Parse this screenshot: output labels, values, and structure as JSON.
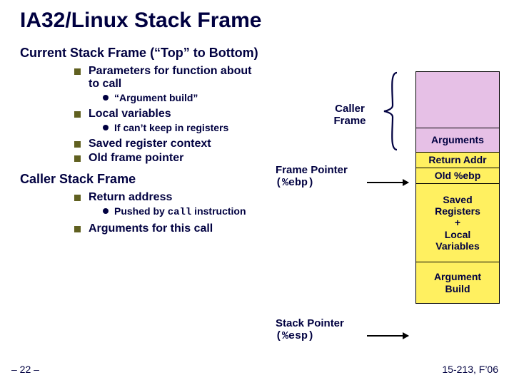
{
  "title": "IA32/Linux Stack Frame",
  "current": {
    "heading": "Current Stack Frame (“Top” to Bottom)",
    "b1": "Parameters for function about to call",
    "b1a": "“Argument build”",
    "b2": "Local variables",
    "b2a": "If can’t keep in registers",
    "b3": "Saved register context",
    "b4": "Old frame pointer"
  },
  "caller": {
    "heading": "Caller Stack Frame",
    "b1": "Return address",
    "b1a_pre": "Pushed by ",
    "b1a_code": "call",
    "b1a_post": " instruction",
    "b2": "Arguments for this call"
  },
  "diagram": {
    "caller_label": "Caller Frame",
    "args": "Arguments",
    "ret": "Return Addr",
    "old": "Old %ebp",
    "saved": "Saved\nRegisters\n+\nLocal\nVariables",
    "build": "Argument\nBuild",
    "fp_label": "Frame Pointer",
    "fp_reg": "(%ebp)",
    "sp_label": "Stack Pointer",
    "sp_reg": "(%esp)"
  },
  "footer": {
    "left": "– 22 –",
    "right": "15-213, F’06"
  }
}
